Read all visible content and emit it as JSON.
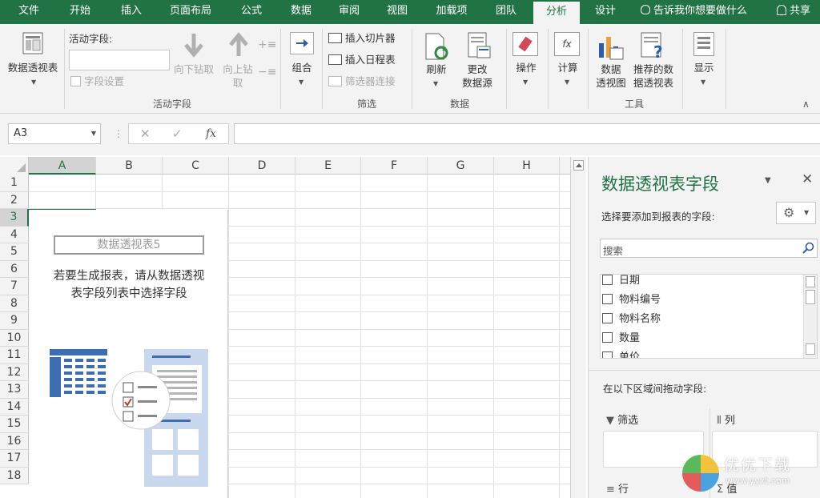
{
  "tabs": [
    {
      "label": "文件"
    },
    {
      "label": "开始"
    },
    {
      "label": "插入"
    },
    {
      "label": "页面布局"
    },
    {
      "label": "公式"
    },
    {
      "label": "数据"
    },
    {
      "label": "审阅"
    },
    {
      "label": "视图"
    },
    {
      "label": "加载项"
    },
    {
      "label": "团队"
    },
    {
      "label": "分析"
    },
    {
      "label": "设计"
    }
  ],
  "active_tab": "分析",
  "tell_me": "告诉我你想要做什么",
  "share": "共享",
  "ribbon": {
    "pivot_btn": "数据透视表",
    "active_field_label": "活动字段:",
    "field_settings": "字段设置",
    "drill_down": "向下钻取",
    "drill_up_1": "向上钻",
    "drill_up_2": "取",
    "group_active_field": "活动字段",
    "group_btn": "组合",
    "insert_slicer": "插入切片器",
    "insert_timeline": "插入日程表",
    "filter_connections": "筛选器连接",
    "group_filter": "筛选",
    "refresh": "刷新",
    "change_source_1": "更改",
    "change_source_2": "数据源",
    "group_data": "数据",
    "actions": "操作",
    "calculations": "计算",
    "pivot_chart_1": "数据",
    "pivot_chart_2": "透视图",
    "recommended_1": "推荐的数",
    "recommended_2": "据透视表",
    "group_tools": "工具",
    "show": "显示"
  },
  "formula_bar": {
    "name_box": "A3",
    "fx": "fx",
    "cancel": "✕",
    "enter": "✓"
  },
  "grid": {
    "columns": [
      "A",
      "B",
      "C",
      "D",
      "E",
      "F",
      "G",
      "H"
    ],
    "rows": [
      "1",
      "2",
      "3",
      "4",
      "5",
      "6",
      "7",
      "8",
      "9",
      "10",
      "11",
      "12",
      "13",
      "14",
      "15",
      "16",
      "17",
      "18"
    ],
    "selected_col": "A",
    "selected_row": "3"
  },
  "pivot_placeholder": {
    "title": "数据透视表5",
    "message_line1": "若要生成报表，请从数据透视",
    "message_line2": "表字段列表中选择字段"
  },
  "field_pane": {
    "title": "数据透视表字段",
    "subtitle": "选择要添加到报表的字段:",
    "search_placeholder": "搜索",
    "fields": [
      {
        "label": "日期"
      },
      {
        "label": "物料编号"
      },
      {
        "label": "物料名称"
      },
      {
        "label": "数量"
      },
      {
        "label": "单价"
      }
    ],
    "drag_label": "在以下区域间拖动字段:",
    "areas": {
      "filters": "筛选",
      "columns": "列",
      "rows": "行",
      "values": "值"
    }
  },
  "watermark": {
    "text": "优优下载",
    "url": "www.yyxt.com"
  },
  "colors": {
    "excel_green": "#217346",
    "ribbon_bg": "#f3f3f3",
    "illustration_blue": "#3d6fb0",
    "illustration_light": "#c9d8ec"
  }
}
